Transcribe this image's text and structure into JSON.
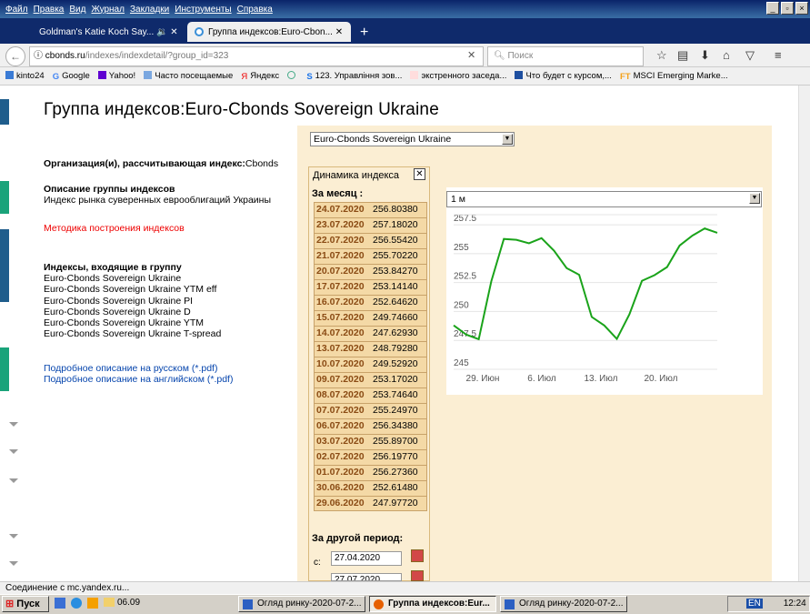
{
  "menu": [
    "Файл",
    "Правка",
    "Вид",
    "Журнал",
    "Закладки",
    "Инструменты",
    "Справка"
  ],
  "tabs": [
    {
      "label": "Goldman's Katie Koch Say... 🔉 ✕"
    },
    {
      "label": "Группа индексов:Euro-Cbon...  ✕"
    }
  ],
  "new_tab": "+",
  "nav": {
    "url_domain": "cbonds.ru",
    "url_path": "/indexes/indexdetail/?group_id=323",
    "search_placeholder": "Поиск"
  },
  "bookmarks": [
    "kinto24",
    "Google",
    "Yahoo!",
    "Часто посещаемые",
    "Яндекс",
    "",
    "123. Управління зов...",
    "экстренного заседа...",
    "Что будет с курсом,...",
    "MSCI Emerging Marke..."
  ],
  "page": {
    "title": "Группа индексов:Euro-Cbonds Sovereign Ukraine",
    "org_label": "Организация(и), рассчитывающая индекс:",
    "org_value": "Cbonds",
    "desc_label": "Описание группы индексов",
    "desc_value": "Индекс рынка суверенных еврооблигаций Украины",
    "method_link": "Методика построения индексов",
    "indexes_label": "Индексы, входящие в группу",
    "indexes": [
      "Euro-Cbonds Sovereign Ukraine",
      "Euro-Cbonds Sovereign Ukraine YTM eff",
      "Euro-Cbonds Sovereign Ukraine PI",
      "Euro-Cbonds Sovereign Ukraine D",
      "Euro-Cbonds Sovereign Ukraine YTM",
      "Euro-Cbonds Sovereign Ukraine T-spread"
    ],
    "pdf_ru": "Подробное описание на русском (*.pdf)",
    "pdf_en": "Подробное описание на английском (*.pdf)"
  },
  "panel": {
    "group_select": "Euro-Cbonds Sovereign Ukraine",
    "dyn_title": "Динамика индекса",
    "dyn_close": "✕",
    "month_label": "За месяц :",
    "rows": [
      {
        "date": "24.07.2020",
        "value": "256.80380"
      },
      {
        "date": "23.07.2020",
        "value": "257.18020"
      },
      {
        "date": "22.07.2020",
        "value": "256.55420"
      },
      {
        "date": "21.07.2020",
        "value": "255.70220"
      },
      {
        "date": "20.07.2020",
        "value": "253.84270"
      },
      {
        "date": "17.07.2020",
        "value": "253.14140"
      },
      {
        "date": "16.07.2020",
        "value": "252.64620"
      },
      {
        "date": "15.07.2020",
        "value": "249.74660"
      },
      {
        "date": "14.07.2020",
        "value": "247.62930"
      },
      {
        "date": "13.07.2020",
        "value": "248.79280"
      },
      {
        "date": "10.07.2020",
        "value": "249.52920"
      },
      {
        "date": "09.07.2020",
        "value": "253.17020"
      },
      {
        "date": "08.07.2020",
        "value": "253.74640"
      },
      {
        "date": "07.07.2020",
        "value": "255.24970"
      },
      {
        "date": "06.07.2020",
        "value": "256.34380"
      },
      {
        "date": "03.07.2020",
        "value": "255.89700"
      },
      {
        "date": "02.07.2020",
        "value": "256.19770"
      },
      {
        "date": "01.07.2020",
        "value": "256.27360"
      },
      {
        "date": "30.06.2020",
        "value": "252.61480"
      },
      {
        "date": "29.06.2020",
        "value": "247.97720"
      }
    ],
    "other_label": "За другой период:",
    "from_label": "с:",
    "from_value": "27.04.2020",
    "to_value": "27.07.2020",
    "range_select": "1 м"
  },
  "chart_data": {
    "type": "line",
    "x": [
      "29.06",
      "30.06",
      "01.07",
      "02.07",
      "03.07",
      "06.07",
      "07.07",
      "08.07",
      "09.07",
      "10.07",
      "13.07",
      "14.07",
      "15.07",
      "16.07",
      "17.07",
      "20.07",
      "21.07",
      "22.07",
      "23.07",
      "24.07"
    ],
    "x_tick_labels": [
      "29. Июн",
      "6. Июл",
      "13. Июл",
      "20. Июл"
    ],
    "y_tick_labels": [
      "245",
      "247.5",
      "250",
      "252.5",
      "255",
      "257.5"
    ],
    "series": [
      {
        "values": [
          248.8,
          248.0,
          247.6,
          252.61,
          256.27,
          256.2,
          255.9,
          256.34,
          255.25,
          253.75,
          253.17,
          249.53,
          248.79,
          247.63,
          249.75,
          252.65,
          253.14,
          253.84,
          255.7,
          256.55,
          257.18,
          256.8
        ]
      }
    ],
    "ylim": [
      245,
      259
    ],
    "color": "#1aa31a",
    "grid": true
  },
  "status": "Соединение с mc.yandex.ru...",
  "taskbar": {
    "start": "Пуск",
    "folder": "06.09",
    "windows": [
      "Огляд ринку-2020-07-2...",
      "Группа индексов:Eur...",
      "Огляд ринку-2020-07-2..."
    ],
    "lang": "EN",
    "clock": "12:24"
  }
}
